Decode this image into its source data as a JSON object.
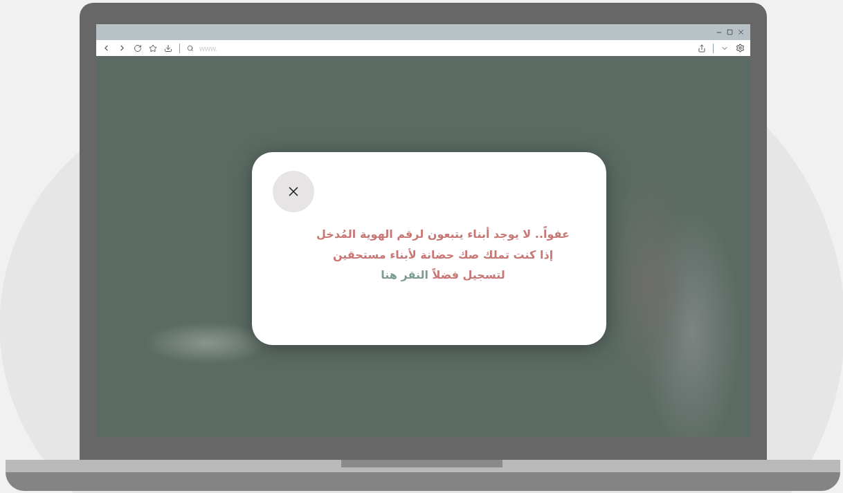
{
  "browser": {
    "address_placeholder": "www."
  },
  "dialog": {
    "lines": [
      "عفواً.. لا يوجد أبناء يتبعون لرقم الهوية المُدخل",
      "إذا كنت تملك صك حضانة لأبناء مستحقين"
    ],
    "action": {
      "prefix": "لتسجيل فضلاً",
      "link": "النقر هنا"
    }
  }
}
